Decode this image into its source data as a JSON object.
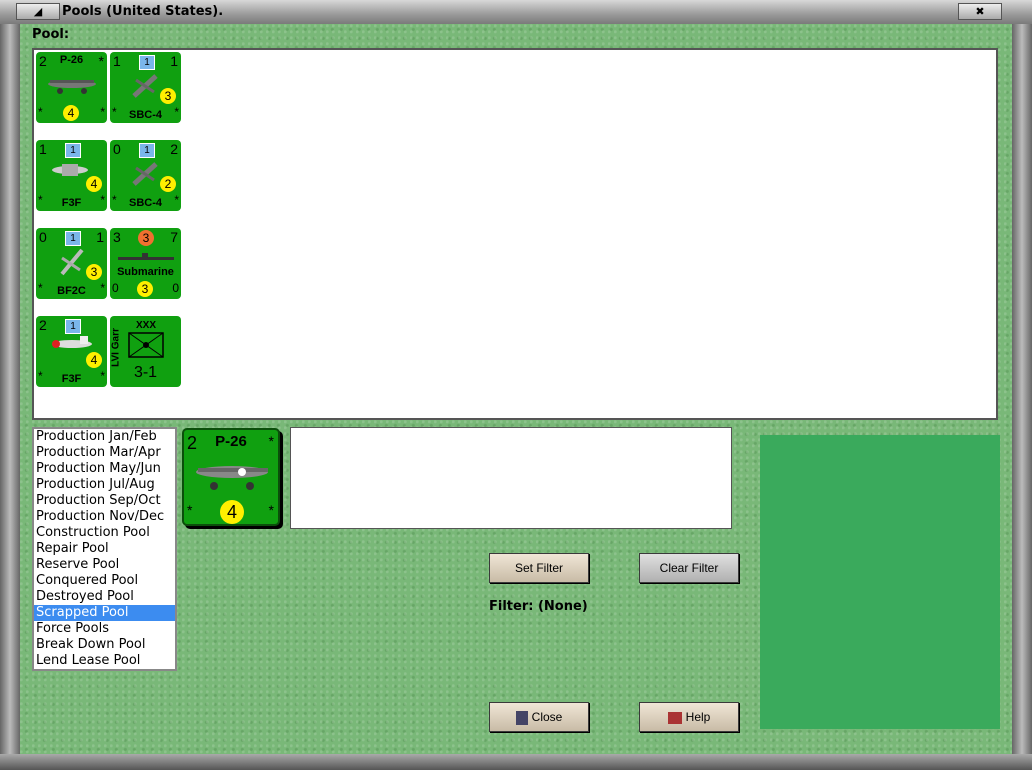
{
  "window": {
    "title": "Pools (United States)."
  },
  "pool": {
    "label": "Pool:",
    "counters": [
      {
        "tl": "2",
        "tr": "*",
        "bl": "*",
        "br": "*",
        "name": "P-26",
        "circle": "4",
        "kind": "plane-top"
      },
      {
        "tl": "1",
        "tr": "1",
        "bl": "*",
        "br": "*",
        "name": "SBC-4",
        "square": "1",
        "circle": "3",
        "kind": "plane"
      },
      {
        "tl": "1",
        "tr": "",
        "bl": "*",
        "br": "*",
        "name": "F3F",
        "square": "1",
        "circle": "4",
        "kind": "plane"
      },
      {
        "tl": "0",
        "tr": "2",
        "bl": "*",
        "br": "*",
        "name": "SBC-4",
        "square": "1",
        "circle": "2",
        "kind": "plane"
      },
      {
        "tl": "0",
        "tr": "1",
        "bl": "*",
        "br": "*",
        "name": "BF2C",
        "square": "1",
        "circle": "3",
        "kind": "plane"
      },
      {
        "tl": "3",
        "tr": "7",
        "bl": "0",
        "br": "0",
        "name": "Submarine",
        "topcircle": "3",
        "circle": "3",
        "kind": "sub"
      },
      {
        "tl": "2",
        "tr": "",
        "bl": "*",
        "br": "*",
        "name": "F3F",
        "square": "1",
        "circle": "4",
        "kind": "plane"
      },
      {
        "name": "LVI Garr",
        "size": "XXX",
        "strength": "3-1",
        "kind": "garrison"
      }
    ]
  },
  "pool_list": {
    "items": [
      "Production Jan/Feb",
      "Production Mar/Apr",
      "Production May/Jun",
      "Production Jul/Aug",
      "Production Sep/Oct",
      "Production Nov/Dec",
      "Construction Pool",
      "Repair Pool",
      "Reserve Pool",
      "Conquered Pool",
      "Destroyed Pool",
      "Scrapped Pool",
      "Force Pools",
      "Break Down Pool",
      "Lend Lease Pool"
    ],
    "selected": "Scrapped Pool"
  },
  "selected_counter": {
    "tl": "2",
    "tr": "*",
    "bl": "*",
    "br": "*",
    "name": "P-26",
    "circle": "4"
  },
  "buttons": {
    "set_filter": "Set Filter",
    "clear_filter": "Clear Filter",
    "close": "Close",
    "help": "Help"
  },
  "filter": {
    "text": "Filter: (None)"
  },
  "colors": {
    "counter_green": "#10a010",
    "selection_blue": "#3c8cf0",
    "preview_green": "#3aaa5c"
  },
  "icons": {
    "close": "close-icon",
    "restore": "restore-icon",
    "close_button_icon": "door-icon",
    "help_button_icon": "book-icon"
  }
}
